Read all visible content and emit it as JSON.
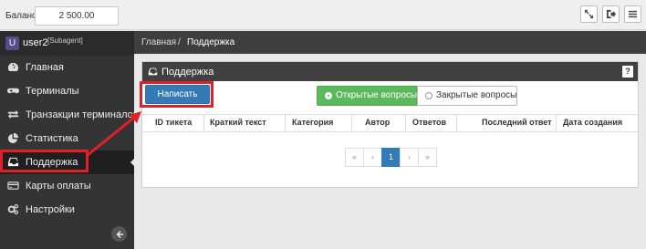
{
  "topbar": {
    "balance_label": "Баланс:",
    "balance_value": "2 500.00",
    "icons": [
      "fullscreen-icon",
      "logout-icon",
      "menu-icon"
    ]
  },
  "sidebar": {
    "user": {
      "avatar_letter": "U",
      "name": "user2",
      "role": "[Subagent]"
    },
    "items": [
      {
        "label": "Главная",
        "icon": "dashboard-icon"
      },
      {
        "label": "Терминалы",
        "icon": "gamepad-icon"
      },
      {
        "label": "Транзакции терминалов",
        "icon": "exchange-icon"
      },
      {
        "label": "Статистика",
        "icon": "pie-chart-icon"
      },
      {
        "label": "Поддержка",
        "icon": "inbox-icon",
        "active": true
      },
      {
        "label": "Карты оплаты",
        "icon": "credit-card-icon"
      },
      {
        "label": "Настройки",
        "icon": "cogs-icon"
      }
    ]
  },
  "breadcrumb": {
    "home": "Главная",
    "separator": "/",
    "current": "Поддержка"
  },
  "panel": {
    "title": "Поддержка",
    "help": "?",
    "write_button": "Написать",
    "toggle_open": "Открытые вопросы",
    "toggle_closed": "Закрытые вопросы",
    "columns": [
      "ID тикета",
      "Краткий текст",
      "Категория",
      "Автор",
      "Ответов",
      "Последний ответ",
      "Дата создания"
    ],
    "pager": [
      "«",
      "‹",
      "1",
      "›",
      "»"
    ],
    "active_page": "1"
  },
  "colors": {
    "primary": "#337ab7",
    "success": "#5cb85c",
    "highlight": "#e11f26",
    "sidebar": "#343434"
  }
}
